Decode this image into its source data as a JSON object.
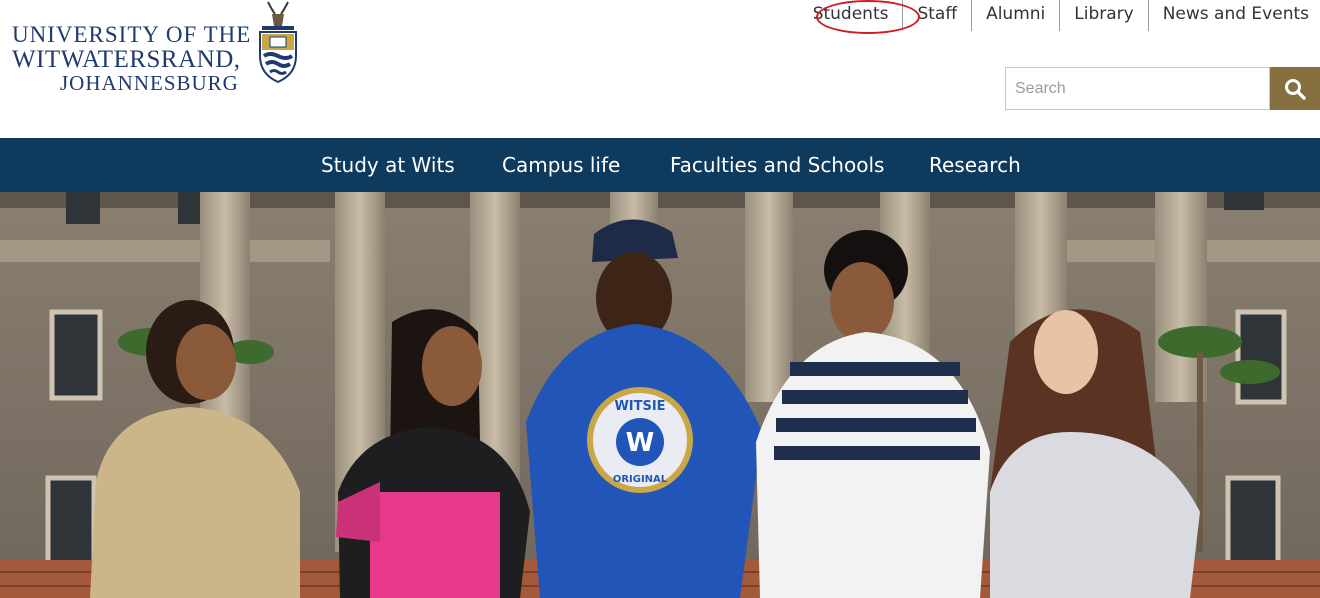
{
  "logo": {
    "line1": "UNIVERSITY OF THE",
    "line2": "WITWATERSRAND,",
    "line3": "JOHANNESBURG"
  },
  "utility_nav": {
    "items": [
      {
        "label": "Students"
      },
      {
        "label": "Staff"
      },
      {
        "label": "Alumni"
      },
      {
        "label": "Library"
      },
      {
        "label": "News and Events"
      }
    ]
  },
  "search": {
    "placeholder": "Search",
    "value": "",
    "button_icon": "magnifier-icon"
  },
  "main_nav": {
    "items": [
      {
        "label": "Study at Wits"
      },
      {
        "label": "Campus life"
      },
      {
        "label": "Faculties and Schools"
      },
      {
        "label": "Research"
      }
    ]
  },
  "hero": {
    "shirt_text": "WITSIE",
    "shirt_badge": "W",
    "shirt_ring": "ORIGINAL"
  },
  "colors": {
    "brand_blue": "#1f3a6e",
    "nav_bar": "#0e3a5e",
    "search_button": "#86703f",
    "highlight": "#d01b22"
  }
}
